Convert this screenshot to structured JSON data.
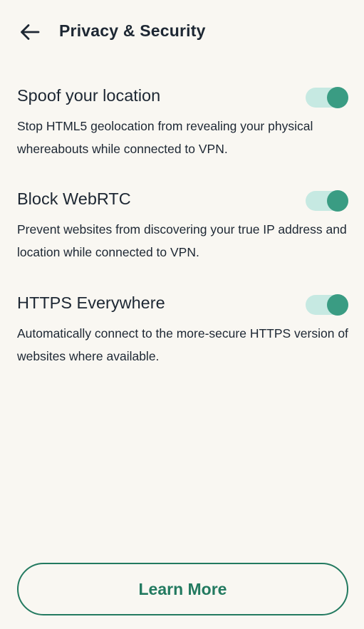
{
  "header": {
    "back_icon": "arrow-left-icon",
    "title": "Privacy & Security"
  },
  "settings": [
    {
      "title": "Spoof your location",
      "description": "Stop HTML5 geolocation from revealing your physical whereabouts while connected to VPN.",
      "enabled": true
    },
    {
      "title": "Block WebRTC",
      "description": "Prevent websites from discovering your true IP address and location while connected to VPN.",
      "enabled": true
    },
    {
      "title": "HTTPS Everywhere",
      "description": "Automatically connect to the more-secure HTTPS version of websites where available.",
      "enabled": true
    }
  ],
  "footer": {
    "learn_more_label": "Learn More"
  },
  "colors": {
    "background": "#f9f7f2",
    "text": "#1d2733",
    "accent": "#237a60",
    "toggle_thumb": "#3a9c83",
    "toggle_track": "#c6e9e2"
  }
}
